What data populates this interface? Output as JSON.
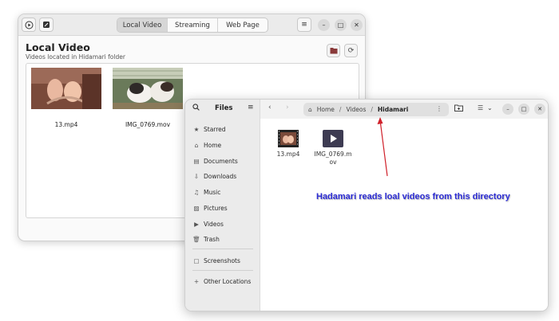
{
  "hidamari": {
    "tabs": [
      "Local Video",
      "Streaming",
      "Web Page"
    ],
    "title": "Local Video",
    "subtitle": "Videos located in Hidamari folder",
    "videos": [
      {
        "name": "13.mp4"
      },
      {
        "name": "IMG_0769.mov"
      }
    ],
    "icons": {
      "play": "play-icon",
      "app": "hidamari-app-icon",
      "menu": "hamburger-menu-icon",
      "folder": "open-folder-icon",
      "refresh": "refresh-icon"
    }
  },
  "files": {
    "title": "Files",
    "sidebar": [
      {
        "icon": "★",
        "label": "Starred"
      },
      {
        "icon": "⌂",
        "label": "Home"
      },
      {
        "icon": "▤",
        "label": "Documents"
      },
      {
        "icon": "⇩",
        "label": "Downloads"
      },
      {
        "icon": "♫",
        "label": "Music"
      },
      {
        "icon": "▨",
        "label": "Pictures"
      },
      {
        "icon": "▶",
        "label": "Videos"
      },
      {
        "icon": "🗑",
        "label": "Trash"
      },
      {
        "icon": "▢",
        "label": "Screenshots"
      },
      {
        "icon": "+",
        "label": "Other Locations"
      }
    ],
    "path": {
      "home": "Home",
      "videos": "Videos",
      "current": "Hidamari",
      "separator": "/"
    },
    "file_items": [
      {
        "label": "13.mp4"
      },
      {
        "label_line1": "IMG_0769.m",
        "label_line2": "ov"
      }
    ]
  },
  "annotation": {
    "text": "Hadamari reads loal videos from this directory",
    "color": "#2b2bd4",
    "arrow_color": "#d0202a"
  }
}
